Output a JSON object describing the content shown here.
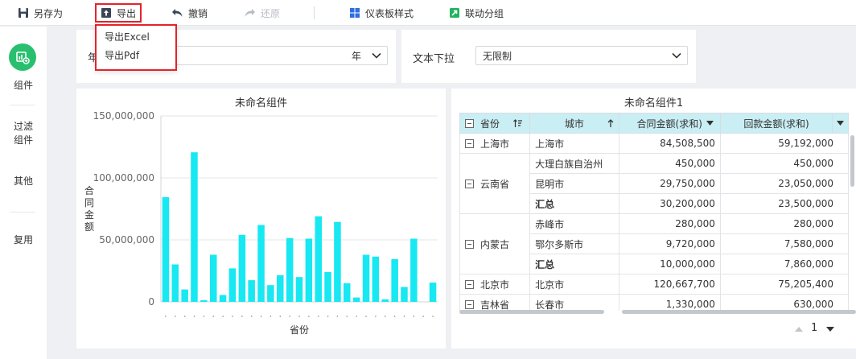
{
  "toolbar": {
    "save_as": "另存为",
    "export": "导出",
    "undo": "撤销",
    "redo": "还原",
    "dashboard_style": "仪表板样式",
    "linked_group": "联动分组"
  },
  "export_menu": {
    "items": [
      "导出Excel",
      "导出Pdf"
    ]
  },
  "sidebar": {
    "items": [
      {
        "label": "组件"
      },
      {
        "label": "过滤\n组件"
      },
      {
        "label": "其他"
      },
      {
        "label": "复用"
      }
    ]
  },
  "filters": {
    "year": {
      "label": "年",
      "value": "年"
    },
    "text_dropdown": {
      "label": "文本下拉",
      "value": "无限制"
    }
  },
  "chart_widget": {
    "title": "未命名组件",
    "chart_data": {
      "type": "bar",
      "ylabel": "合同金额",
      "xlabel": "省份",
      "ylim": [
        0,
        150000000
      ],
      "y_ticks": [
        "150,000,000",
        "100,000,000",
        "50,000,000",
        "0"
      ],
      "y_tick_values": [
        150000000,
        100000000,
        50000000,
        0
      ],
      "bar_color": "#17e8f2",
      "values": [
        84508500,
        30200000,
        10000000,
        120667700,
        1330000,
        38000000,
        5500000,
        27000000,
        54000000,
        17500000,
        62000000,
        13500000,
        21500000,
        51500000,
        20000000,
        51000000,
        69000000,
        24000000,
        64500000,
        15000000,
        3500000,
        38000000,
        36500000,
        2000000,
        34500000,
        12000000,
        51000000,
        0,
        15500000
      ]
    }
  },
  "table_widget": {
    "title": "未命名组件1",
    "headers": [
      "省份",
      "城市",
      "合同金额(求和)",
      "回款金额(求和)"
    ],
    "groups": [
      {
        "province": "上海市",
        "rows": [
          {
            "city": "上海市",
            "contract": "84,508,500",
            "payment": "59,192,000"
          }
        ]
      },
      {
        "province": "云南省",
        "rows": [
          {
            "city": "大理白族自治州",
            "contract": "450,000",
            "payment": "450,000"
          },
          {
            "city": "昆明市",
            "contract": "29,750,000",
            "payment": "23,050,000"
          },
          {
            "city": "汇总",
            "contract": "30,200,000",
            "payment": "23,500,000",
            "summary": true
          }
        ]
      },
      {
        "province": "内蒙古",
        "rows": [
          {
            "city": "赤峰市",
            "contract": "280,000",
            "payment": "280,000"
          },
          {
            "city": "鄂尔多斯市",
            "contract": "9,720,000",
            "payment": "7,580,000"
          },
          {
            "city": "汇总",
            "contract": "10,000,000",
            "payment": "7,860,000",
            "summary": true
          }
        ]
      },
      {
        "province": "北京市",
        "rows": [
          {
            "city": "北京市",
            "contract": "120,667,700",
            "payment": "75,205,400"
          }
        ]
      },
      {
        "province": "吉林省",
        "rows": [
          {
            "city": "长春市",
            "contract": "1,330,000",
            "payment": "630,000"
          }
        ]
      }
    ],
    "page": "1"
  },
  "colors": {
    "accent": "#28c06e",
    "highlight": "#e5232a",
    "bar": "#17e8f2",
    "header_bg": "#c9eef3"
  }
}
